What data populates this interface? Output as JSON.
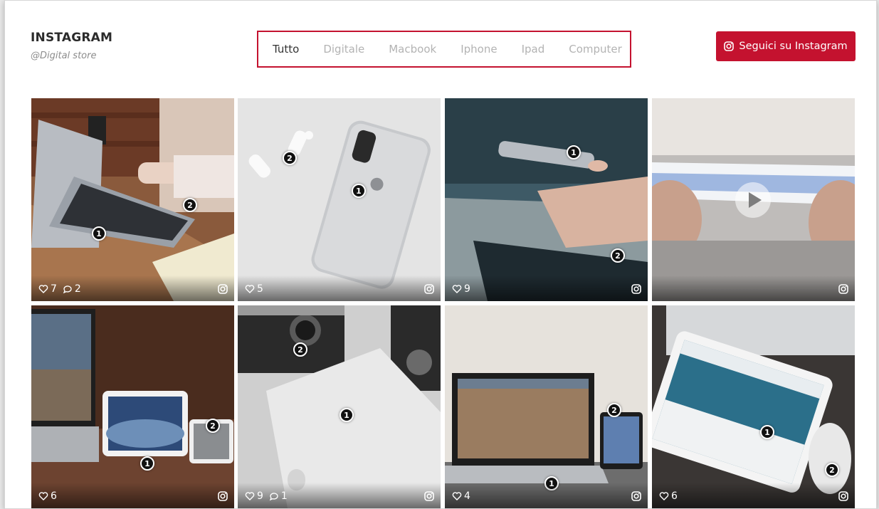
{
  "header": {
    "title": "INSTAGRAM",
    "handle": "@Digital store",
    "follow_label": "Seguici su Instagram"
  },
  "filters": [
    {
      "label": "Tutto",
      "active": true
    },
    {
      "label": "Digitale",
      "active": false
    },
    {
      "label": "Macbook",
      "active": false
    },
    {
      "label": "Iphone",
      "active": false
    },
    {
      "label": "Ipad",
      "active": false
    },
    {
      "label": "Computer",
      "active": false
    }
  ],
  "posts": [
    {
      "likes": "7",
      "comments": "2",
      "hotspots": [
        "1",
        "2"
      ],
      "video": false
    },
    {
      "likes": "5",
      "comments": null,
      "hotspots": [
        "1",
        "2"
      ],
      "video": false
    },
    {
      "likes": "9",
      "comments": null,
      "hotspots": [
        "1",
        "2"
      ],
      "video": false
    },
    {
      "likes": null,
      "comments": null,
      "hotspots": [],
      "video": true
    },
    {
      "likes": "6",
      "comments": null,
      "hotspots": [
        "1",
        "2"
      ],
      "video": false
    },
    {
      "likes": "9",
      "comments": "1",
      "hotspots": [
        "1",
        "2"
      ],
      "video": false
    },
    {
      "likes": "4",
      "comments": null,
      "hotspots": [
        "1",
        "2"
      ],
      "video": false
    },
    {
      "likes": "6",
      "comments": null,
      "hotspots": [
        "1",
        "2"
      ],
      "video": false
    }
  ],
  "colors": {
    "accent": "#c4122f",
    "filter_active": "#333333",
    "filter_inactive": "#b3b3b3"
  },
  "icons": {
    "follow": "instagram-icon",
    "like": "heart-icon",
    "comment": "comment-icon",
    "tile": "instagram-icon",
    "video": "play-icon"
  }
}
